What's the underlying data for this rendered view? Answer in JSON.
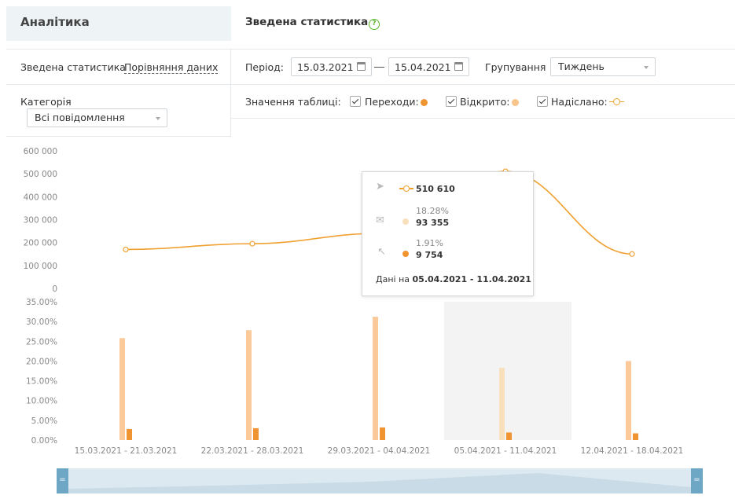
{
  "sidebar": {
    "title": "Аналітика",
    "nav": [
      "Зведена статистика",
      "Порівняння даних"
    ],
    "category_label": "Категорія",
    "category_value": "Всі повідомлення"
  },
  "header": {
    "title": "Зведена статистика",
    "help": "?"
  },
  "filters": {
    "period_label": "Період:",
    "date_from": "15.03.2021",
    "date_to": "15.04.2021",
    "grouping_label": "Групування",
    "grouping_value": "Тиждень"
  },
  "table_values": {
    "label": "Значення таблиці:",
    "items": [
      {
        "label": "Переходи:",
        "color": "#f09432",
        "checked": true
      },
      {
        "label": "Відкрито:",
        "color": "#f7c48a",
        "checked": true
      },
      {
        "label": "Надіслано:",
        "color": "#f0a030",
        "checked": true
      }
    ]
  },
  "tooltip": {
    "sent": "510 610",
    "opened_pct": "18.28%",
    "opened": "93 355",
    "clicks_pct": "1.91%",
    "clicks": "9 754",
    "footer_prefix": "Дані на",
    "footer_range": "05.04.2021 - 11.04.2021"
  },
  "chart_data": [
    {
      "type": "line",
      "categories": [
        "15.03.2021 - 21.03.2021",
        "22.03.2021 - 28.03.2021",
        "29.03.2021 - 04.04.2021",
        "05.04.2021 - 11.04.2021",
        "12.04.2021 - 18.04.2021"
      ],
      "series": [
        {
          "name": "Надіслано:",
          "values": [
            170000,
            195000,
            240000,
            510610,
            150000
          ],
          "color": "#f0a030"
        }
      ],
      "yticks": [
        "0",
        "100 000",
        "200 000",
        "300 000",
        "400 000",
        "500 000",
        "600 000"
      ],
      "ylim": [
        0,
        600000
      ],
      "grid": false
    },
    {
      "type": "bar",
      "categories": [
        "15.03.2021 - 21.03.2021",
        "22.03.2021 - 28.03.2021",
        "29.03.2021 - 04.04.2021",
        "05.04.2021 - 11.04.2021",
        "12.04.2021 - 18.04.2021"
      ],
      "series": [
        {
          "name": "Відкрито:",
          "values": [
            25.8,
            27.8,
            31.2,
            18.28,
            20.0
          ],
          "color": "#fbc99a"
        },
        {
          "name": "Переходи:",
          "values": [
            2.8,
            3.0,
            3.2,
            1.91,
            1.7
          ],
          "color": "#f09432"
        }
      ],
      "yticks": [
        "0.00%",
        "5.00%",
        "10.00%",
        "15.00%",
        "20.00%",
        "25.00%",
        "30.00%",
        "35.00%"
      ],
      "ylim": [
        0,
        35
      ],
      "highlight_index": 3,
      "highlight_color": "#f3f3f3"
    }
  ]
}
